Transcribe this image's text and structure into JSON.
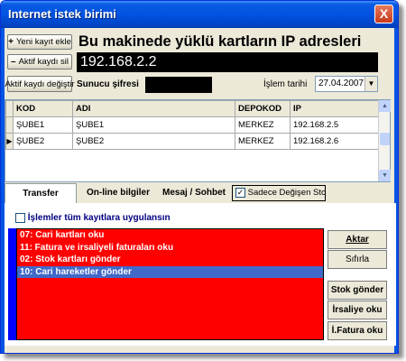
{
  "window": {
    "title": "Internet istek birimi",
    "close_glyph": "X"
  },
  "toolbar": {
    "add_label": "Yeni kayıt ekle",
    "add_glyph": "+",
    "delete_label": "Aktif kaydı sil",
    "delete_glyph": "–",
    "change_label": "Aktif kaydı değiştir"
  },
  "header": {
    "heading": "Bu makinede yüklü kartların IP adresleri",
    "ip_value": "192.168.2.2",
    "server_password_label": "Sunucu şifresi",
    "date_label": "İşlem tarihi",
    "date_value": "27.04.2007"
  },
  "grid": {
    "columns": [
      "KOD",
      "ADI",
      "DEPOKOD",
      "IP"
    ],
    "rows": [
      {
        "indicator": "",
        "kod": "ŞUBE1",
        "adi": "ŞUBE1",
        "depokod": "MERKEZ",
        "ip": "192.168.2.5"
      },
      {
        "indicator": "▶",
        "kod": "ŞUBE2",
        "adi": "ŞUBE2",
        "depokod": "MERKEZ",
        "ip": "192.168.2.6"
      }
    ]
  },
  "tabs": [
    {
      "label": "Transfer işlemleri",
      "active": true
    },
    {
      "label": "On-line bilgiler",
      "active": false
    },
    {
      "label": "Mesaj / Sohbet",
      "active": false
    }
  ],
  "only_changed_stocks": {
    "label": "Sadece Değişen Stoklar",
    "checked": true,
    "mark": "✓"
  },
  "transfer": {
    "apply_all_label": "İşlemler tüm kayıtlara uygulansın",
    "apply_all_checked": false,
    "items": [
      {
        "label": "07: Cari kartları oku",
        "selected": false
      },
      {
        "label": "11: Fatura ve irsaliyeli faturaları oku",
        "selected": false
      },
      {
        "label": "02: Stok kartları gönder",
        "selected": false
      },
      {
        "label": "10: Cari hareketler gönder",
        "selected": true
      }
    ],
    "buttons": {
      "aktar": "Aktar",
      "sifirla": "Sıfırla",
      "stok_gonder": "Stok gönder",
      "irsaliye_oku": "İrsaliye oku",
      "fatura_oku": "İ.Fatura oku"
    }
  },
  "colors": {
    "titlebar": "#0054e3",
    "list_background": "#ff0000",
    "list_selection": "#4169c9",
    "side_bar": "#0000ff"
  },
  "icons": {
    "close": "close-icon",
    "dropdown": "chevron-down-icon",
    "row_pointer": "row-pointer-icon"
  }
}
